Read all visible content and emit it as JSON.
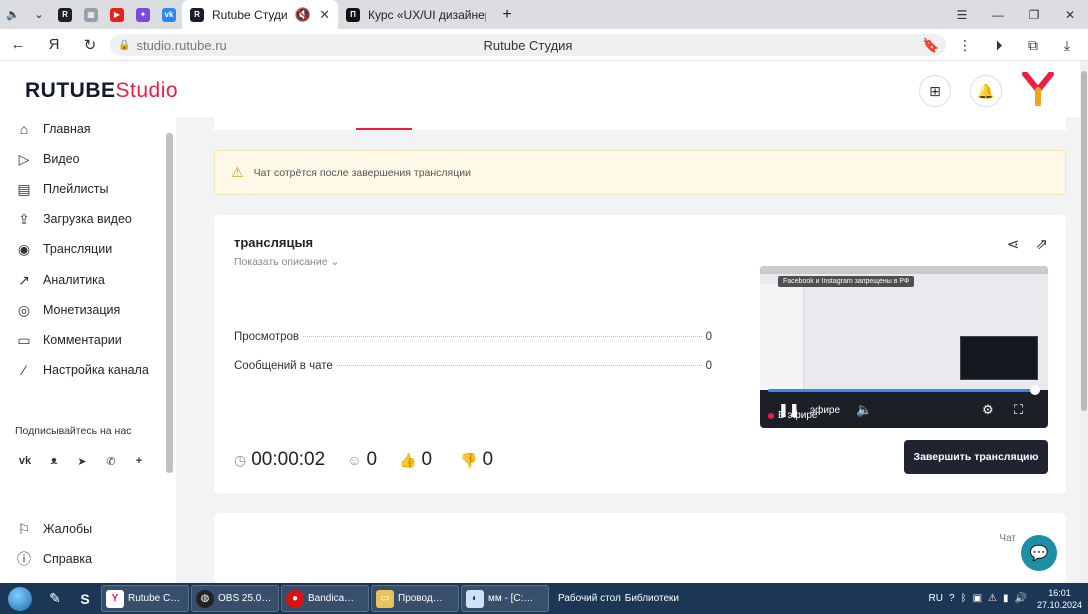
{
  "browser": {
    "tabs": [
      {
        "title": "Rutube Студия",
        "active": true
      },
      {
        "title": "Курс «UX/UI дизайнер и…",
        "active": false
      }
    ],
    "url": "studio.rutube.ru",
    "page_title": "Rutube Студия"
  },
  "app": {
    "logo_main": "RUTUBE",
    "logo_studio": "Studio"
  },
  "sidebar": {
    "items": [
      {
        "label": "Главная",
        "icon": "home-icon"
      },
      {
        "label": "Видео",
        "icon": "video-icon"
      },
      {
        "label": "Плейлисты",
        "icon": "playlist-icon"
      },
      {
        "label": "Загрузка видео",
        "icon": "upload-icon"
      },
      {
        "label": "Трансляции",
        "icon": "broadcast-icon"
      },
      {
        "label": "Аналитика",
        "icon": "analytics-icon"
      },
      {
        "label": "Монетизация",
        "icon": "money-icon"
      },
      {
        "label": "Комментарии",
        "icon": "comments-icon"
      },
      {
        "label": "Настройка канала",
        "icon": "settings-wand-icon"
      }
    ],
    "subscribe_label": "Подписывайтесь на нас",
    "socials": [
      "vk",
      "ok",
      "telegram",
      "viber",
      "more"
    ],
    "bottom_items": [
      {
        "label": "Жалобы",
        "icon": "complaints-icon"
      },
      {
        "label": "Справка",
        "icon": "help-icon"
      }
    ]
  },
  "main": {
    "warning": "Чат сотрётся после завершения трансляции",
    "stream": {
      "title": "трансляцыя",
      "show_description": "Показать описание",
      "stats": [
        {
          "label": "Просмотров",
          "value": "0"
        },
        {
          "label": "Сообщений в чате",
          "value": "0"
        }
      ],
      "timer": "00:00:02",
      "viewers": "0",
      "likes": "0",
      "dislikes": "0",
      "end_button": "Завершить трансляцию"
    },
    "preview": {
      "banner": "Facebook и Instagram запрещены в РФ",
      "live_label": "В эфире",
      "live_overlay": "эфире",
      "progress": 0.98
    },
    "chat_label": "Чат"
  },
  "taskbar": {
    "items": [
      {
        "label": "Rutube С…"
      },
      {
        "label": "OBS 25.0…"
      },
      {
        "label": "Bandica…"
      },
      {
        "label": "Провод…"
      },
      {
        "label": "мм - [C:…"
      }
    ],
    "desktop_label": "Рабочий стол",
    "libraries_label": "Библиотеки",
    "lang": "RU",
    "time": "16:01",
    "date": "27.10.2024"
  }
}
